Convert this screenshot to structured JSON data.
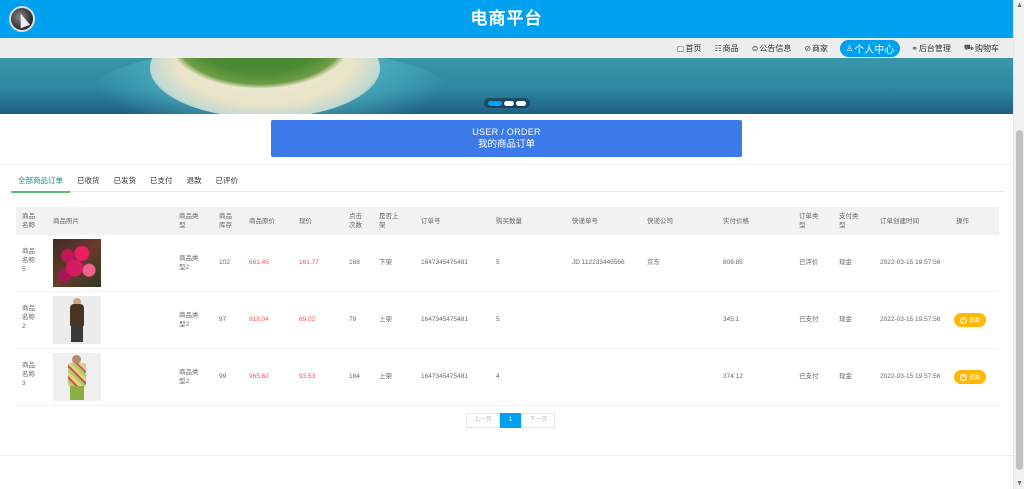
{
  "site": {
    "title": "电商平台"
  },
  "nav": {
    "items": [
      {
        "icon": "home-icon",
        "glyph": "▢",
        "label": "首页"
      },
      {
        "icon": "grid-icon",
        "glyph": "☷",
        "label": "商品"
      },
      {
        "icon": "notice-icon",
        "glyph": "⊜",
        "label": "公告信息"
      },
      {
        "icon": "chat-icon",
        "glyph": "⊘",
        "label": "商家"
      },
      {
        "icon": "user-icon",
        "glyph": "♙",
        "label": "个人中心",
        "active": true
      },
      {
        "icon": "link-icon",
        "glyph": "⚭",
        "label": "后台管理"
      },
      {
        "icon": "cart-icon",
        "glyph": "⛟",
        "label": "购物车"
      }
    ]
  },
  "banner": {
    "dot_count": 3,
    "active_dot": 0
  },
  "order_header": {
    "en": "USER / ORDER",
    "zh": "我的商品订单"
  },
  "tabs": [
    "全部商品订单",
    "已收货",
    "已发货",
    "已支付",
    "退款",
    "已评价"
  ],
  "active_tab": 0,
  "table": {
    "headers": {
      "name": "商品名称",
      "photo": "商品照片",
      "type": "商品类型",
      "stock": "商品库存",
      "original_price": "商品原价",
      "price": "现价",
      "clicks": "点击次数",
      "listed": "是否上架",
      "order_no": "订单号",
      "quantity": "购买数量",
      "tracking_no": "快递单号",
      "courier": "快递公司",
      "paid": "实付价格",
      "order_type": "订单类型",
      "pay_type": "支付类型",
      "created": "订单创建时间",
      "action": "操作"
    },
    "rows": [
      {
        "name": "商品名称5",
        "photo": "flowers",
        "type": "商品类型2",
        "stock": "102",
        "original_price": "661.45",
        "price": "161.77",
        "clicks": "168",
        "listed": "下架",
        "order_no": "1647345475481",
        "quantity": "5",
        "tracking_no": "JD 112233445566",
        "courier": "京东",
        "paid": "808.85",
        "order_type": "已评价",
        "pay_type": "现金",
        "created": "2022-03-15 19:57:56",
        "action": ""
      },
      {
        "name": "商品名称2",
        "photo": "man",
        "type": "商品类型2",
        "stock": "97",
        "original_price": "818.04",
        "price": "69.02",
        "clicks": "79",
        "listed": "上架",
        "order_no": "1647345475481",
        "quantity": "5",
        "tracking_no": "",
        "courier": "",
        "paid": "345.1",
        "order_type": "已支付",
        "pay_type": "现金",
        "created": "2022-03-15 19:57:56",
        "action": "退款"
      },
      {
        "name": "商品名称3",
        "photo": "woman",
        "type": "商品类型2",
        "stock": "99",
        "original_price": "965.62",
        "price": "93.53",
        "clicks": "184",
        "listed": "上架",
        "order_no": "1647345475481",
        "quantity": "4",
        "tracking_no": "",
        "courier": "",
        "paid": "374.12",
        "order_type": "已支付",
        "pay_type": "现金",
        "created": "2022-03-15 19:57:56",
        "action": "退款"
      }
    ]
  },
  "pager": {
    "prev": "上一页",
    "current": "1",
    "next": "下一页"
  },
  "colors": {
    "primary": "#00a0f0",
    "header_blue": "#3b7ae8",
    "price_red": "#ff4d4f",
    "refund_orange": "#ffb800",
    "tab_active": "#009688"
  }
}
